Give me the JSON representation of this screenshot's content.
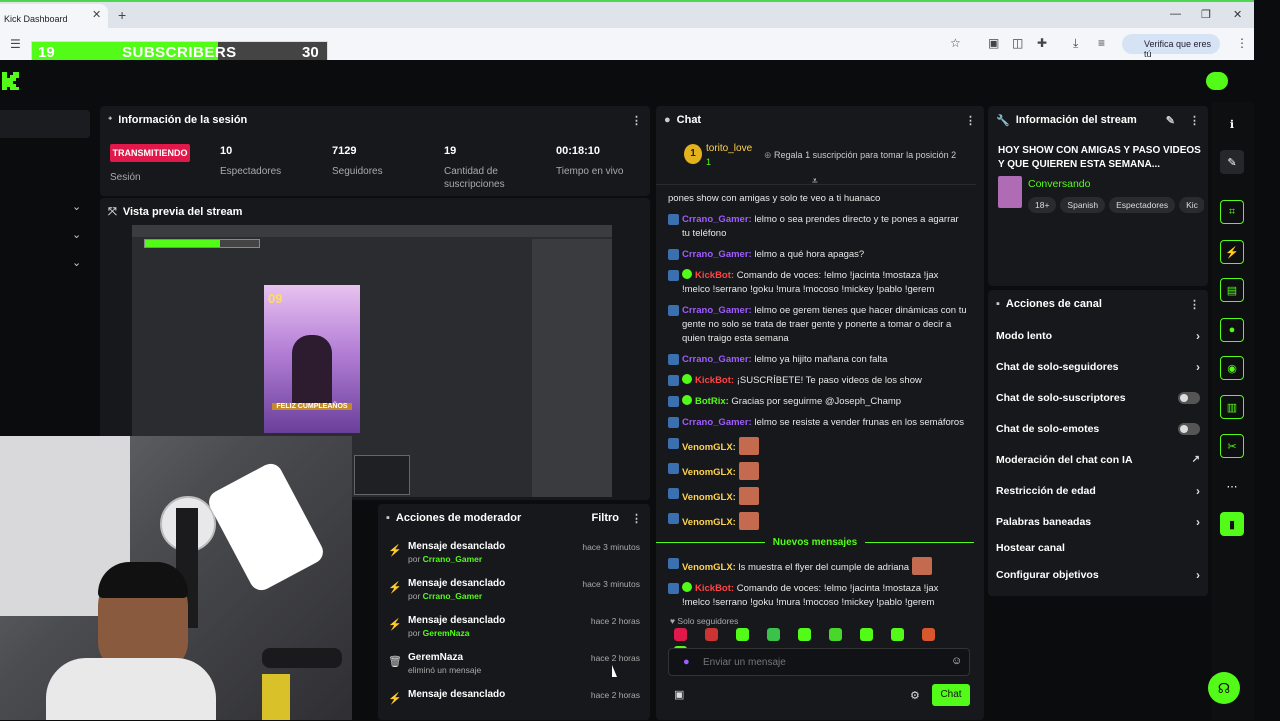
{
  "browser": {
    "tab_title": "Kick Dashboard",
    "verify_label": "Verifica que eres tú"
  },
  "subscriber_goal": {
    "current": "19",
    "label": "SUBSCRIBERS",
    "target": "30",
    "fill_fraction": 0.63
  },
  "session": {
    "title": "Información de la sesión",
    "status": "TRANSMITIENDO",
    "status_sub": "Sesión",
    "stats": [
      {
        "value": "10",
        "label": "Espectadores"
      },
      {
        "value": "7129",
        "label": "Seguidores"
      },
      {
        "value": "19",
        "label": "Cantidad de suscripciones"
      },
      {
        "value": "00:18:10",
        "label": "Tiempo en vivo"
      }
    ]
  },
  "preview": {
    "title": "Vista previa del stream",
    "flyer_number": "09",
    "flyer_text": "FELIZ CUMPLEAÑOS"
  },
  "moderator": {
    "title": "Acciones de moderador",
    "filter": "Filtro",
    "items": [
      {
        "title": "Mensaje desanclado",
        "by": "por",
        "user": "Crrano_Gamer",
        "time": "hace 3 minutos"
      },
      {
        "title": "Mensaje desanclado",
        "by": "por",
        "user": "Crrano_Gamer",
        "time": "hace 3 minutos"
      },
      {
        "title": "Mensaje desanclado",
        "by": "por",
        "user": "GeremNaza",
        "time": "hace 2 horas"
      },
      {
        "title": "GeremNaza",
        "by": "eliminó un mensaje",
        "user": "",
        "time": "hace 2 horas"
      },
      {
        "title": "Mensaje desanclado",
        "by": "",
        "user": "",
        "time": "hace 2 horas"
      }
    ]
  },
  "chat": {
    "title": "Chat",
    "top_user": "torito_love",
    "top_count": "1",
    "gift_text": "Regala 1 suscripción para tomar la posición 2",
    "messages": [
      {
        "user": "",
        "cls": "",
        "text": "pones show con amigas y solo te veo a ti huanaco"
      },
      {
        "user": "Crrano_Gamer:",
        "cls": "u-purple",
        "text": " lelmo o sea prendes directo y te pones a agarrar tu teléfono"
      },
      {
        "user": "Crrano_Gamer:",
        "cls": "u-purple",
        "text": " lelmo a qué hora apagas?"
      },
      {
        "user": "KickBot:",
        "cls": "u-red",
        "text": " Comando de voces: !elmo !jacinta !mostaza !jax !melco !serrano !goku !mura !mocoso !mickey !pablo !gerem"
      },
      {
        "user": "Crrano_Gamer:",
        "cls": "u-purple",
        "text": " lelmo oe gerem tienes que hacer dinámicas con tu gente no solo se trata de traer gente y ponerte a tomar o decir a quien traigo esta semana"
      },
      {
        "user": "Crrano_Gamer:",
        "cls": "u-purple",
        "text": " lelmo ya hijito mañana con falta"
      },
      {
        "user": "KickBot:",
        "cls": "u-red",
        "text": " ¡SUSCRÍBETE! Te paso videos de los show"
      },
      {
        "user": "BotRix:",
        "cls": "u-green",
        "text": " Gracias por seguirme @Joseph_Champ"
      },
      {
        "user": "Crrano_Gamer:",
        "cls": "u-purple",
        "text": " lelmo se resiste a vender frunas en los semáforos"
      },
      {
        "user": "VenomGLX:",
        "cls": "u-yellow",
        "text": ""
      },
      {
        "user": "VenomGLX:",
        "cls": "u-yellow",
        "text": ""
      },
      {
        "user": "VenomGLX:",
        "cls": "u-yellow",
        "text": ""
      },
      {
        "user": "VenomGLX:",
        "cls": "u-yellow",
        "text": ""
      }
    ],
    "new_messages": "Nuevos mensajes",
    "messages_after": [
      {
        "user": "VenomGLX:",
        "cls": "u-yellow",
        "text": " ls muestra el flyer del cumple de adriana"
      },
      {
        "user": "KickBot:",
        "cls": "u-red",
        "text": " Comando de voces: !elmo !jacinta !mostaza !jax !melco !serrano !goku !mura !mocoso !mickey !pablo !gerem"
      }
    ],
    "mode": "Solo seguidores",
    "placeholder": "Enviar un mensaje",
    "send": "Chat"
  },
  "stream_info": {
    "title": "Información del stream",
    "stream_title": "HOY SHOW CON AMIGAS Y PASO VIDEOS Y QUE QUIEREN ESTA SEMANA...",
    "category": "Conversando",
    "tags": [
      "18+",
      "Spanish",
      "Espectadores",
      "Kic"
    ]
  },
  "channel_actions": {
    "title": "Acciones de canal",
    "items": [
      {
        "label": "Modo lento",
        "ctl": "chev"
      },
      {
        "label": "Chat de solo-seguidores",
        "ctl": "chev"
      },
      {
        "label": "Chat de solo-suscriptores",
        "ctl": "toggle"
      },
      {
        "label": "Chat de solo-emotes",
        "ctl": "toggle"
      },
      {
        "label": "Moderación del chat con IA",
        "ctl": "ext"
      },
      {
        "label": "Restricción de edad",
        "ctl": "chev"
      },
      {
        "label": "Palabras baneadas",
        "ctl": "chev"
      },
      {
        "label": "Hostear canal",
        "ctl": ""
      },
      {
        "label": "Configurar objetivos",
        "ctl": "chev"
      }
    ]
  },
  "colors": {
    "accent": "#53fc18",
    "live": "#e0194a",
    "panel": "#17181b"
  }
}
